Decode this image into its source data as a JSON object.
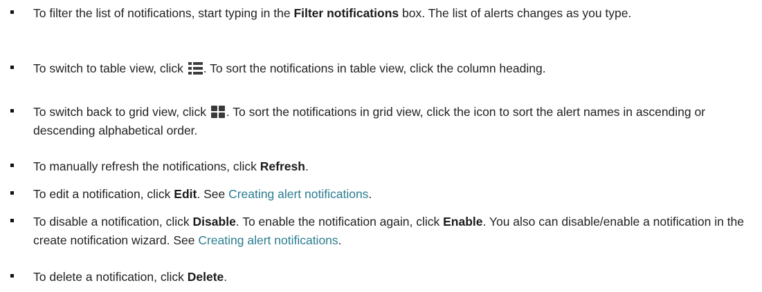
{
  "items": [
    {
      "lines": [
        "To filter the list of notifications, start typing in the ",
        "Filter notifications",
        " box. The list of alerts changes as you type."
      ]
    },
    {
      "pre": "To switch to table view, click ",
      "icon": "table-view-icon",
      "post": ". To sort the notifications in table view, click the column heading."
    },
    {
      "pre": "To switch back to grid view, click ",
      "icon": "grid-view-icon",
      "post": ". To sort the notifications in grid view, click the icon to sort the alert names in ascending or descending alphabetical order."
    },
    {
      "pre": "To manually refresh the notifications, click ",
      "strong": "Refresh",
      "post": "."
    },
    {
      "pre": "To edit a notification, click ",
      "strong": "Edit",
      "mid": ". See ",
      "link": "Creating alert notifications",
      "post": "."
    },
    {
      "pre": "To disable a notification, click ",
      "strong1": "Disable",
      "mid": ". To enable the notification again, click ",
      "strong2": "Enable",
      "mid2": ". You also can disable/enable a notification in the create notification wizard. See ",
      "link": "Creating alert notifications",
      "post": "."
    },
    {
      "pre": "To delete a notification, click ",
      "strong": "Delete",
      "post": "."
    }
  ]
}
